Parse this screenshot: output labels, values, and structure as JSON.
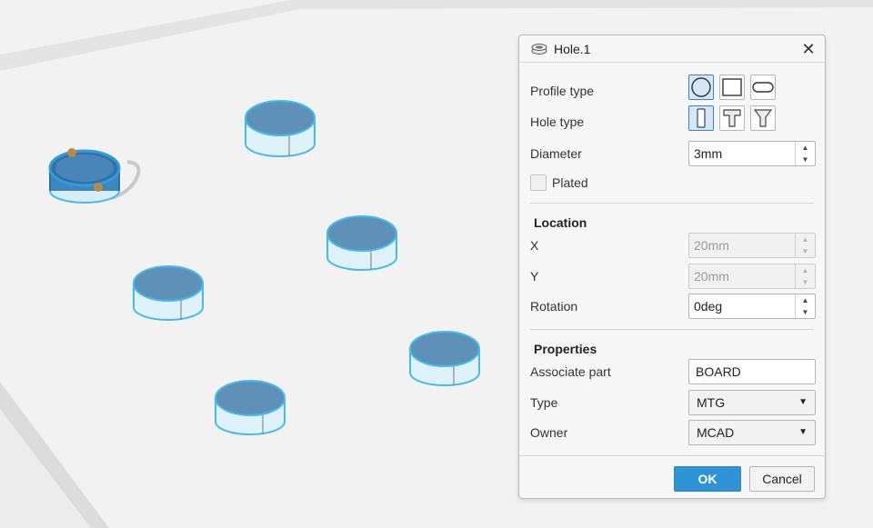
{
  "dialog": {
    "title": "Hole.1",
    "title_icon": "hole-icon",
    "close_glyph": "✕"
  },
  "profile": {
    "label": "Profile type",
    "options": [
      "circle-profile-icon",
      "rectangle-profile-icon",
      "slot-profile-icon"
    ],
    "selected": "circle-profile-icon"
  },
  "hole_type": {
    "label": "Hole type",
    "options": [
      "simple-hole-icon",
      "counterbore-hole-icon",
      "countersink-hole-icon"
    ],
    "selected": "simple-hole-icon"
  },
  "diameter": {
    "label": "Diameter",
    "value": "3mm"
  },
  "plated": {
    "label": "Plated",
    "checked": false
  },
  "location": {
    "heading": "Location",
    "x": {
      "label": "X",
      "value": "20mm"
    },
    "y": {
      "label": "Y",
      "value": "20mm"
    },
    "rotation": {
      "label": "Rotation",
      "value": "0deg"
    }
  },
  "properties": {
    "heading": "Properties",
    "associate_part": {
      "label": "Associate part",
      "value": "BOARD"
    },
    "type": {
      "label": "Type",
      "value": "MTG"
    },
    "owner": {
      "label": "Owner",
      "value": "MCAD"
    }
  },
  "buttons": {
    "ok": "OK",
    "cancel": "Cancel"
  },
  "colors": {
    "accent": "#2f94d6",
    "hole_edge": "#3eb8ec",
    "hole_fill": "#5e8fb5",
    "board": "#f2f2f2"
  }
}
